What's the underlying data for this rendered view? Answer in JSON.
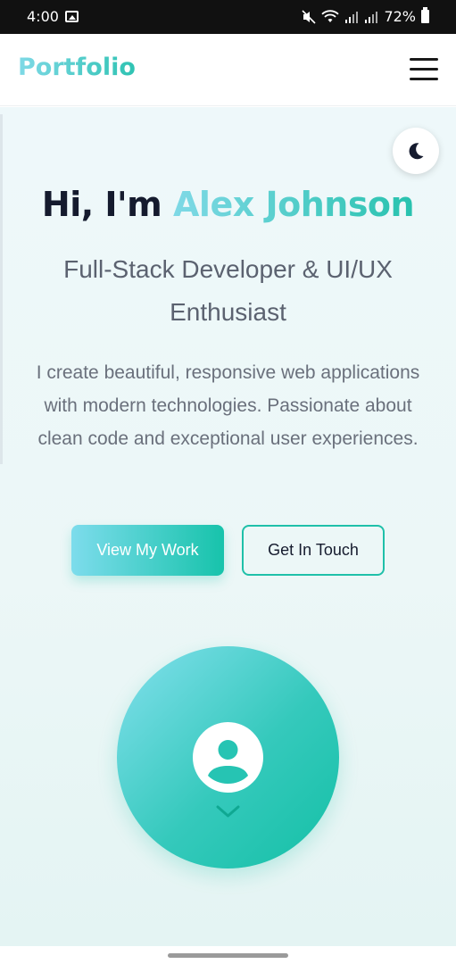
{
  "status_bar": {
    "time": "4:00",
    "battery": "72%",
    "icons": [
      "image-icon",
      "mute-icon",
      "wifi-icon",
      "signal-icon",
      "signal-icon",
      "battery-icon"
    ]
  },
  "header": {
    "logo": "Portfolio",
    "menu_icon": "hamburger-menu-icon"
  },
  "theme_toggle": {
    "icon": "moon-icon"
  },
  "hero": {
    "greeting": "Hi, I'm",
    "name": "Alex Johnson",
    "subtitle": "Full-Stack Developer & UI/UX Enthusiast",
    "description": "I create beautiful, responsive web applications with modern technologies. Passionate about clean code and exceptional user experiences.",
    "primary_button": "View My Work",
    "secondary_button": "Get In Touch",
    "avatar_icon": "user-icon",
    "scroll_icon": "chevron-down-icon"
  },
  "colors": {
    "accent_start": "#7fd9e6",
    "accent_end": "#14c0a6",
    "heading": "#151b2e",
    "text": "#6a707c"
  }
}
